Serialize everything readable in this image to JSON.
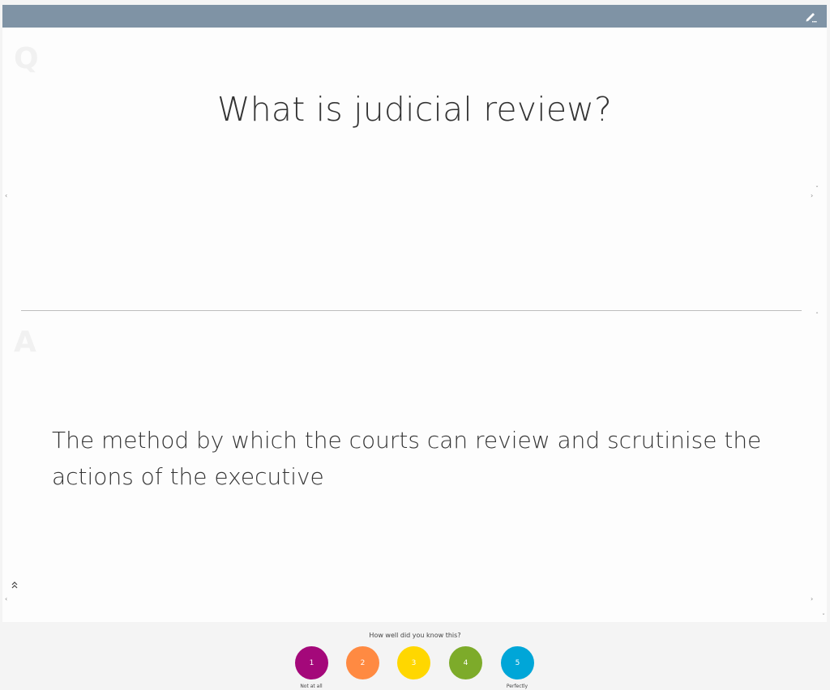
{
  "card": {
    "question_label": "Q",
    "answer_label": "A",
    "question": "What is judicial review?",
    "answer": "The method by which the courts can review and scrutinise the actions of the executive"
  },
  "rating": {
    "prompt": "How well did you know this?",
    "buttons": [
      {
        "label": "1",
        "color": "#a4087a"
      },
      {
        "label": "2",
        "color": "#ff8a42"
      },
      {
        "label": "3",
        "color": "#ffd700"
      },
      {
        "label": "4",
        "color": "#7dab2a"
      },
      {
        "label": "5",
        "color": "#00a6d8"
      }
    ],
    "low_caption": "Not at all",
    "high_caption": "Perfectly"
  },
  "colors": {
    "topbar": "#7f93a5",
    "card_bg": "#fdfdfd"
  },
  "icons": {
    "edit": "pencil-icon",
    "expand": "double-chevron-up-icon"
  }
}
